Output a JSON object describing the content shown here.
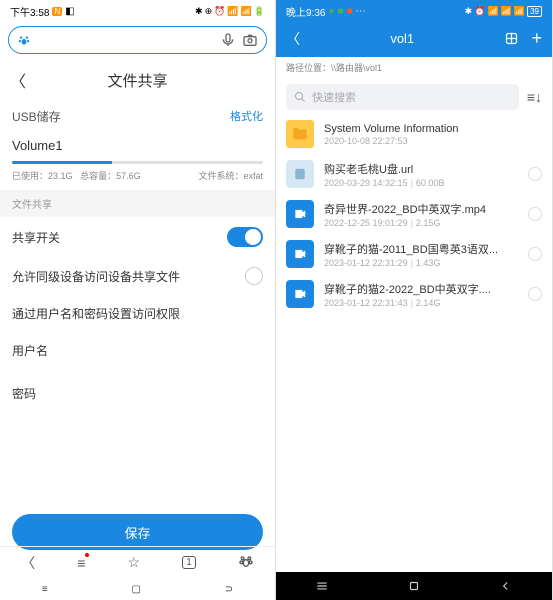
{
  "left": {
    "status_time": "下午3:58",
    "title": "文件共享",
    "usb_label": "USB储存",
    "format_label": "格式化",
    "volume_name": "Volume1",
    "used_label": "已使用",
    "used_value": "23.1G",
    "total_label": "总容量",
    "total_value": "57.6G",
    "fs_label": "文件系统",
    "fs_value": "exfat",
    "share_section": "文件共享",
    "share_toggle": "共享开关",
    "allow_peer": "允许同级设备访问设备共享文件",
    "auth_label": "通过用户名和密码设置访问权限",
    "username_label": "用户名",
    "password_label": "密码",
    "save_label": "保存"
  },
  "right": {
    "status_time": "晚上9:36",
    "battery": "39",
    "title": "vol1",
    "path_label": "路径位置：",
    "path_value": "\\\\路由器\\vol1",
    "search_placeholder": "快速搜索",
    "files": [
      {
        "name": "System Volume Information",
        "date": "2020-10-08 22:27:53",
        "size": "",
        "type": "folder"
      },
      {
        "name": "购买老毛桃U盘.url",
        "date": "2020-03-29 14:32:15",
        "size": "60.00B",
        "type": "url"
      },
      {
        "name": "奇异世界-2022_BD中英双字.mp4",
        "date": "2022-12-25 19:01:29",
        "size": "2.15G",
        "type": "video"
      },
      {
        "name": "穿靴子的猫-2011_BD国粤英3语双...",
        "date": "2023-01-12 22:31:29",
        "size": "1.43G",
        "type": "video"
      },
      {
        "name": "穿靴子的猫2-2022_BD中英双字....",
        "date": "2023-01-12 22:31:43",
        "size": "2.14G",
        "type": "video"
      }
    ]
  }
}
